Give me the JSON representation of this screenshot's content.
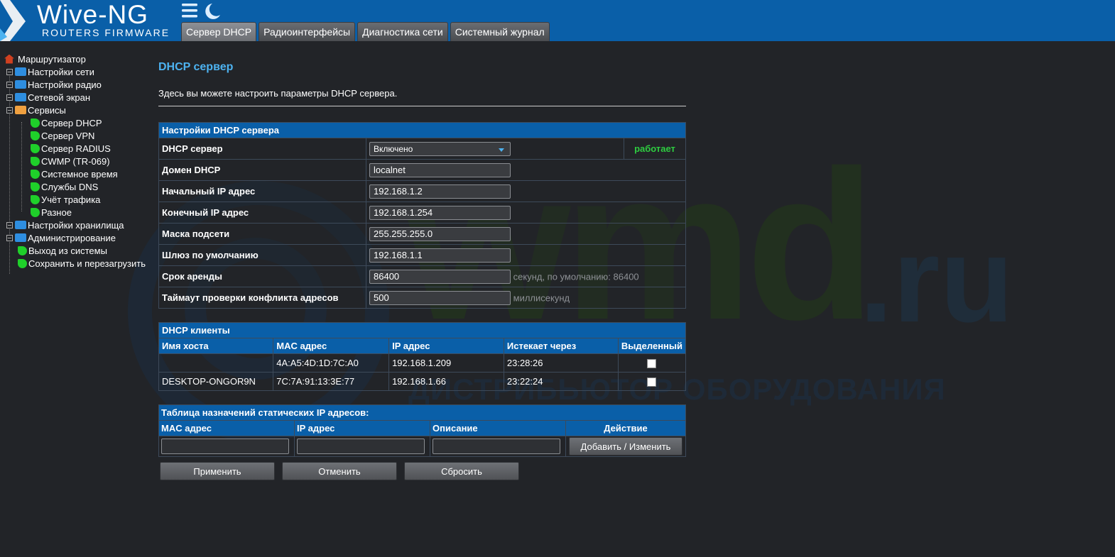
{
  "header": {
    "logo_title": "Wive-NG",
    "logo_subtitle": "ROUTERS FIRMWARE",
    "tabs": [
      {
        "label": "Сервер DHCP"
      },
      {
        "label": "Радиоинтерфейсы"
      },
      {
        "label": "Диагностика сети"
      },
      {
        "label": "Системный журнал"
      }
    ],
    "active_tab": "Сервер DHCP",
    "icons": [
      "menu-icon",
      "moon-icon"
    ]
  },
  "sidebar": {
    "root": "Маршрутизатор",
    "items": [
      {
        "label": "Настройки сети"
      },
      {
        "label": "Настройки радио"
      },
      {
        "label": "Сетевой экран"
      },
      {
        "label": "Сервисы"
      },
      {
        "label": "Сервер DHCP"
      },
      {
        "label": "Сервер VPN"
      },
      {
        "label": "Сервер RADIUS"
      },
      {
        "label": "CWMP (TR-069)"
      },
      {
        "label": "Системное время"
      },
      {
        "label": "Службы DNS"
      },
      {
        "label": "Учёт трафика"
      },
      {
        "label": "Разное"
      },
      {
        "label": "Настройки хранилища"
      },
      {
        "label": "Администрирование"
      },
      {
        "label": "Выход из системы"
      },
      {
        "label": "Сохранить и перезагрузить"
      }
    ]
  },
  "main": {
    "title": "DHCP сервер",
    "description": "Здесь вы можете настроить параметры DHCP сервера.",
    "settings": {
      "section_title": "Настройки DHCP сервера",
      "dhcp_server_label": "DHCP сервер",
      "dhcp_server_value": "Включено",
      "dhcp_status": "работает",
      "domain_label": "Домен DHCP",
      "domain_value": "localnet",
      "start_ip_label": "Начальный IP адрес",
      "start_ip_value": "192.168.1.2",
      "end_ip_label": "Конечный IP адрес",
      "end_ip_value": "192.168.1.254",
      "mask_label": "Маска подсети",
      "mask_value": "255.255.255.0",
      "gateway_label": "Шлюз по умолчанию",
      "gateway_value": "192.168.1.1",
      "lease_label": "Срок аренды",
      "lease_value": "86400",
      "lease_hint": "секунд, по умолчанию: 86400",
      "conflict_label": "Таймаут проверки конфликта адресов",
      "conflict_value": "500",
      "conflict_hint": "миллисекунд"
    },
    "clients": {
      "section_title": "DHCP клиенты",
      "columns": [
        "Имя хоста",
        "MAC адрес",
        "IP адрес",
        "Истекает через",
        "Выделенный"
      ],
      "rows": [
        {
          "host": "",
          "mac": "4A:A5:4D:1D:7C:A0",
          "ip": "192.168.1.209",
          "expires": "23:28:26",
          "reserved": false
        },
        {
          "host": "DESKTOP-ONGOR9N",
          "mac": "7C:7A:91:13:3E:77",
          "ip": "192.168.1.66",
          "expires": "23:22:24",
          "reserved": false
        }
      ]
    },
    "static": {
      "section_title": "Таблица назначений статических IP адресов:",
      "columns": [
        "MAC адрес",
        "IP адрес",
        "Описание",
        "Действие"
      ],
      "add_button": "Добавить / Изменить"
    },
    "buttons": {
      "apply": "Применить",
      "cancel": "Отменить",
      "reset": "Сбросить"
    }
  },
  "watermark": {
    "big": "wmd",
    "suffix": ".ru",
    "tagline": "ДИСТРИБЬЮТОР ОБОРУДОВАНИЯ СВЯЗИ"
  },
  "colors": {
    "header_bg": "#0a5fa8",
    "page_bg": "#222428",
    "title": "#4db2f0",
    "status_ok": "#2ecc40"
  }
}
